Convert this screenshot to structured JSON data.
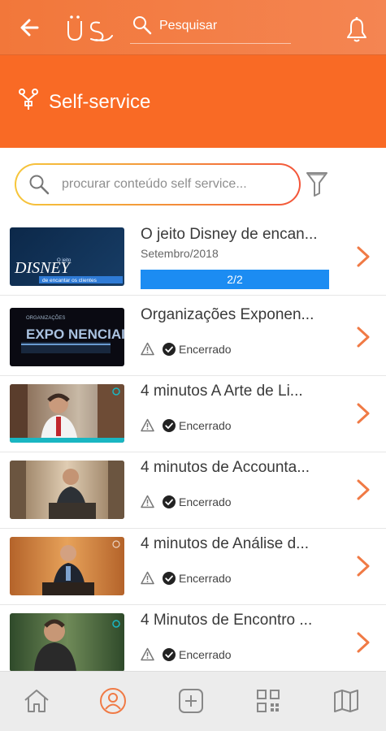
{
  "header": {
    "back_icon": "back-arrow-icon",
    "logo_icon": "us-logo",
    "search_placeholder": "Pesquisar",
    "search_icon": "search-icon",
    "bell_icon": "bell-icon"
  },
  "hero": {
    "icon": "self-service-icon",
    "title": "Self-service",
    "background": "#f96a25"
  },
  "content_search": {
    "placeholder": "procurar conteúdo self service...",
    "filter_icon": "filter-icon"
  },
  "items": [
    {
      "title": "O jeito Disney de encan...",
      "subtitle": "Setembro/2018",
      "progress_label": "2/2",
      "progress": 1.0,
      "thumb_text_top": "O jeito",
      "thumb_text_main": "DISNEY",
      "thumb_text_sub": "de encantar os clientes"
    },
    {
      "title": "Organizações Exponen...",
      "status": "Encerrado",
      "thumb_text_top": "ORGANIZAÇÕES",
      "thumb_text_main": "EXPO NENCIAIS"
    },
    {
      "title": "4 minutos A Arte de Li...",
      "status": "Encerrado"
    },
    {
      "title": "4 minutos de Accounta...",
      "status": "Encerrado"
    },
    {
      "title": "4 minutos de Análise d...",
      "status": "Encerrado"
    },
    {
      "title": "4 Minutos de Encontro ...",
      "status": "Encerrado"
    }
  ],
  "tabbar": {
    "tabs": [
      "home-icon",
      "profile-icon",
      "add-icon",
      "qr-code-icon",
      "map-icon"
    ],
    "active": "profile-icon",
    "active_color": "#f07a45"
  }
}
